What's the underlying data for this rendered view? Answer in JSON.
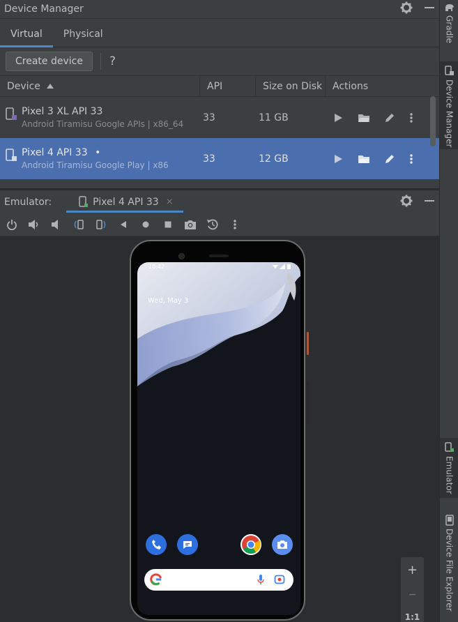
{
  "device_manager": {
    "title": "Device Manager",
    "tabs": [
      "Virtual",
      "Physical"
    ],
    "create_label": "Create device",
    "help": "?",
    "columns": {
      "device": "Device",
      "api": "API",
      "size": "Size on Disk",
      "actions": "Actions"
    },
    "rows": [
      {
        "name": "Pixel 3 XL API 33",
        "subtitle": "Android Tiramisu Google APIs | x86_64",
        "api": "33",
        "size": "11 GB",
        "selected": false
      },
      {
        "name": "Pixel 4 API 33",
        "dot": "•",
        "subtitle": "Android Tiramisu Google Play | x86",
        "api": "33",
        "size": "12 GB",
        "selected": true
      }
    ]
  },
  "emulator": {
    "label": "Emulator:",
    "tab": "Pixel 4 API 33",
    "close": "×",
    "screen": {
      "time": "10:42",
      "date": "Wed, May 3"
    },
    "zoom": {
      "plus": "+",
      "minus": "−",
      "one_to_one": "1:1"
    }
  },
  "side_tabs": [
    "Gradle",
    "Device Manager",
    "Emulator",
    "Device File Explorer"
  ],
  "colors": {
    "accent": "#4a88c7",
    "selection": "#4b6eaf",
    "panel": "#3c3f41"
  }
}
